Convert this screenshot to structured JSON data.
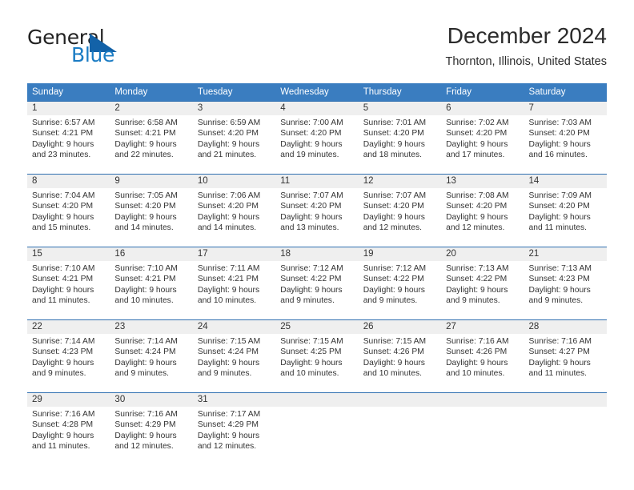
{
  "brand": {
    "word1": "General",
    "word2": "Blue",
    "logo_icon": "triangle-logo-icon",
    "accent_color": "#1b7cc4"
  },
  "header": {
    "title": "December 2024",
    "subtitle": "Thornton, Illinois, United States"
  },
  "calendar": {
    "header_color": "#3a7dc0",
    "weekdays": [
      "Sunday",
      "Monday",
      "Tuesday",
      "Wednesday",
      "Thursday",
      "Friday",
      "Saturday"
    ],
    "weeks": [
      [
        {
          "day": "1",
          "sunrise": "Sunrise: 6:57 AM",
          "sunset": "Sunset: 4:21 PM",
          "daylight1": "Daylight: 9 hours",
          "daylight2": "and 23 minutes."
        },
        {
          "day": "2",
          "sunrise": "Sunrise: 6:58 AM",
          "sunset": "Sunset: 4:21 PM",
          "daylight1": "Daylight: 9 hours",
          "daylight2": "and 22 minutes."
        },
        {
          "day": "3",
          "sunrise": "Sunrise: 6:59 AM",
          "sunset": "Sunset: 4:20 PM",
          "daylight1": "Daylight: 9 hours",
          "daylight2": "and 21 minutes."
        },
        {
          "day": "4",
          "sunrise": "Sunrise: 7:00 AM",
          "sunset": "Sunset: 4:20 PM",
          "daylight1": "Daylight: 9 hours",
          "daylight2": "and 19 minutes."
        },
        {
          "day": "5",
          "sunrise": "Sunrise: 7:01 AM",
          "sunset": "Sunset: 4:20 PM",
          "daylight1": "Daylight: 9 hours",
          "daylight2": "and 18 minutes."
        },
        {
          "day": "6",
          "sunrise": "Sunrise: 7:02 AM",
          "sunset": "Sunset: 4:20 PM",
          "daylight1": "Daylight: 9 hours",
          "daylight2": "and 17 minutes."
        },
        {
          "day": "7",
          "sunrise": "Sunrise: 7:03 AM",
          "sunset": "Sunset: 4:20 PM",
          "daylight1": "Daylight: 9 hours",
          "daylight2": "and 16 minutes."
        }
      ],
      [
        {
          "day": "8",
          "sunrise": "Sunrise: 7:04 AM",
          "sunset": "Sunset: 4:20 PM",
          "daylight1": "Daylight: 9 hours",
          "daylight2": "and 15 minutes."
        },
        {
          "day": "9",
          "sunrise": "Sunrise: 7:05 AM",
          "sunset": "Sunset: 4:20 PM",
          "daylight1": "Daylight: 9 hours",
          "daylight2": "and 14 minutes."
        },
        {
          "day": "10",
          "sunrise": "Sunrise: 7:06 AM",
          "sunset": "Sunset: 4:20 PM",
          "daylight1": "Daylight: 9 hours",
          "daylight2": "and 14 minutes."
        },
        {
          "day": "11",
          "sunrise": "Sunrise: 7:07 AM",
          "sunset": "Sunset: 4:20 PM",
          "daylight1": "Daylight: 9 hours",
          "daylight2": "and 13 minutes."
        },
        {
          "day": "12",
          "sunrise": "Sunrise: 7:07 AM",
          "sunset": "Sunset: 4:20 PM",
          "daylight1": "Daylight: 9 hours",
          "daylight2": "and 12 minutes."
        },
        {
          "day": "13",
          "sunrise": "Sunrise: 7:08 AM",
          "sunset": "Sunset: 4:20 PM",
          "daylight1": "Daylight: 9 hours",
          "daylight2": "and 12 minutes."
        },
        {
          "day": "14",
          "sunrise": "Sunrise: 7:09 AM",
          "sunset": "Sunset: 4:20 PM",
          "daylight1": "Daylight: 9 hours",
          "daylight2": "and 11 minutes."
        }
      ],
      [
        {
          "day": "15",
          "sunrise": "Sunrise: 7:10 AM",
          "sunset": "Sunset: 4:21 PM",
          "daylight1": "Daylight: 9 hours",
          "daylight2": "and 11 minutes."
        },
        {
          "day": "16",
          "sunrise": "Sunrise: 7:10 AM",
          "sunset": "Sunset: 4:21 PM",
          "daylight1": "Daylight: 9 hours",
          "daylight2": "and 10 minutes."
        },
        {
          "day": "17",
          "sunrise": "Sunrise: 7:11 AM",
          "sunset": "Sunset: 4:21 PM",
          "daylight1": "Daylight: 9 hours",
          "daylight2": "and 10 minutes."
        },
        {
          "day": "18",
          "sunrise": "Sunrise: 7:12 AM",
          "sunset": "Sunset: 4:22 PM",
          "daylight1": "Daylight: 9 hours",
          "daylight2": "and 9 minutes."
        },
        {
          "day": "19",
          "sunrise": "Sunrise: 7:12 AM",
          "sunset": "Sunset: 4:22 PM",
          "daylight1": "Daylight: 9 hours",
          "daylight2": "and 9 minutes."
        },
        {
          "day": "20",
          "sunrise": "Sunrise: 7:13 AM",
          "sunset": "Sunset: 4:22 PM",
          "daylight1": "Daylight: 9 hours",
          "daylight2": "and 9 minutes."
        },
        {
          "day": "21",
          "sunrise": "Sunrise: 7:13 AM",
          "sunset": "Sunset: 4:23 PM",
          "daylight1": "Daylight: 9 hours",
          "daylight2": "and 9 minutes."
        }
      ],
      [
        {
          "day": "22",
          "sunrise": "Sunrise: 7:14 AM",
          "sunset": "Sunset: 4:23 PM",
          "daylight1": "Daylight: 9 hours",
          "daylight2": "and 9 minutes."
        },
        {
          "day": "23",
          "sunrise": "Sunrise: 7:14 AM",
          "sunset": "Sunset: 4:24 PM",
          "daylight1": "Daylight: 9 hours",
          "daylight2": "and 9 minutes."
        },
        {
          "day": "24",
          "sunrise": "Sunrise: 7:15 AM",
          "sunset": "Sunset: 4:24 PM",
          "daylight1": "Daylight: 9 hours",
          "daylight2": "and 9 minutes."
        },
        {
          "day": "25",
          "sunrise": "Sunrise: 7:15 AM",
          "sunset": "Sunset: 4:25 PM",
          "daylight1": "Daylight: 9 hours",
          "daylight2": "and 10 minutes."
        },
        {
          "day": "26",
          "sunrise": "Sunrise: 7:15 AM",
          "sunset": "Sunset: 4:26 PM",
          "daylight1": "Daylight: 9 hours",
          "daylight2": "and 10 minutes."
        },
        {
          "day": "27",
          "sunrise": "Sunrise: 7:16 AM",
          "sunset": "Sunset: 4:26 PM",
          "daylight1": "Daylight: 9 hours",
          "daylight2": "and 10 minutes."
        },
        {
          "day": "28",
          "sunrise": "Sunrise: 7:16 AM",
          "sunset": "Sunset: 4:27 PM",
          "daylight1": "Daylight: 9 hours",
          "daylight2": "and 11 minutes."
        }
      ],
      [
        {
          "day": "29",
          "sunrise": "Sunrise: 7:16 AM",
          "sunset": "Sunset: 4:28 PM",
          "daylight1": "Daylight: 9 hours",
          "daylight2": "and 11 minutes."
        },
        {
          "day": "30",
          "sunrise": "Sunrise: 7:16 AM",
          "sunset": "Sunset: 4:29 PM",
          "daylight1": "Daylight: 9 hours",
          "daylight2": "and 12 minutes."
        },
        {
          "day": "31",
          "sunrise": "Sunrise: 7:17 AM",
          "sunset": "Sunset: 4:29 PM",
          "daylight1": "Daylight: 9 hours",
          "daylight2": "and 12 minutes."
        },
        {
          "day": "",
          "sunrise": "",
          "sunset": "",
          "daylight1": "",
          "daylight2": ""
        },
        {
          "day": "",
          "sunrise": "",
          "sunset": "",
          "daylight1": "",
          "daylight2": ""
        },
        {
          "day": "",
          "sunrise": "",
          "sunset": "",
          "daylight1": "",
          "daylight2": ""
        },
        {
          "day": "",
          "sunrise": "",
          "sunset": "",
          "daylight1": "",
          "daylight2": ""
        }
      ]
    ]
  }
}
